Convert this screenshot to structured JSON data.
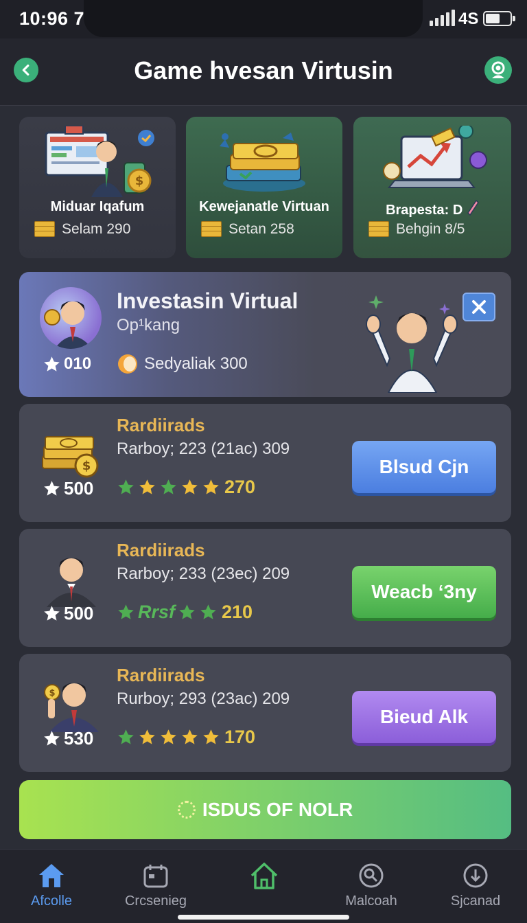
{
  "status_bar": {
    "time": "10:96 7",
    "network": "4S"
  },
  "header": {
    "title": "Game hvesan Virtusin"
  },
  "categories": [
    {
      "name": "Miduar Iqafum",
      "value": "Selam 290"
    },
    {
      "name": "Kewejanatle Virtuan",
      "value": "Setan 258"
    },
    {
      "name": "Brapesta: D",
      "value": "Behgin 8/5"
    }
  ],
  "featured": {
    "title": "Investasin Virtual",
    "subtitle": "Op¹kang",
    "score": "010",
    "note": "Sedyaliak 300"
  },
  "investments": [
    {
      "name": "Rardiirads",
      "desc": "Rarboy; 223 (21aс) 309",
      "score": "500",
      "rating_value": "270",
      "button": "Blsud Cjn"
    },
    {
      "name": "Rardiirads",
      "desc": "Rarboy; 233 (23eс) 209",
      "score": "500",
      "rating_text": "Rrsf",
      "rating_value": "210",
      "button": "Weacb ‘3ny"
    },
    {
      "name": "Rardiirads",
      "desc": "Rurboy; 293 (23aс) 209",
      "score": "530",
      "rating_value": "170",
      "button": "Bieud Alk"
    }
  ],
  "cta": {
    "label": "ISDUS OF NOLR"
  },
  "nav": [
    {
      "label": "Afcolle",
      "icon": "home-icon",
      "active": true
    },
    {
      "label": "Crcsenieg",
      "icon": "calendar-icon"
    },
    {
      "label": "",
      "icon": "house-outline-icon"
    },
    {
      "label": "Malcoah",
      "icon": "search-icon"
    },
    {
      "label": "Sjcanad",
      "icon": "download-icon"
    }
  ],
  "colors": {
    "accent_green": "#3bb07a",
    "gold_text": "#e8b756",
    "nav_active": "#5b9bf0"
  }
}
